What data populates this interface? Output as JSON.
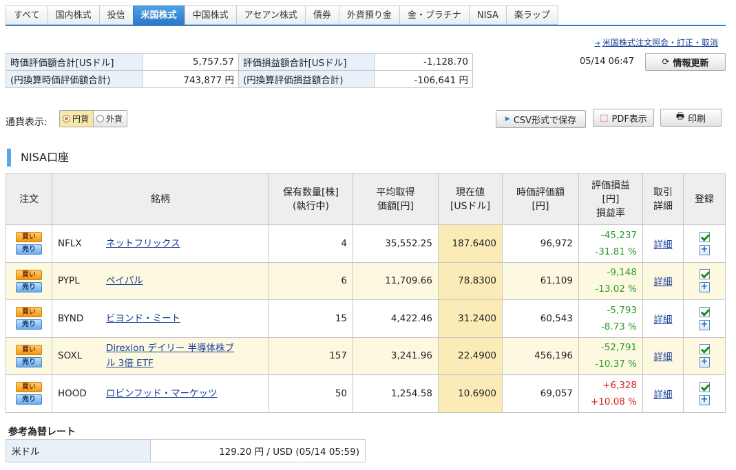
{
  "tabs": [
    {
      "label": "すべて",
      "active": false
    },
    {
      "label": "国内株式",
      "active": false
    },
    {
      "label": "投信",
      "active": false
    },
    {
      "label": "米国株式",
      "active": true
    },
    {
      "label": "中国株式",
      "active": false
    },
    {
      "label": "アセアン株式",
      "active": false
    },
    {
      "label": "債券",
      "active": false
    },
    {
      "label": "外貨預り金",
      "active": false
    },
    {
      "label": "金・プラチナ",
      "active": false
    },
    {
      "label": "NISA",
      "active": false
    },
    {
      "label": "楽ラップ",
      "active": false
    }
  ],
  "header": {
    "order_link": "米国株式注文照会・訂正・取消",
    "update_time": "05/14 06:47",
    "refresh_label": "情報更新"
  },
  "summary": {
    "market_value_usd_label": "時価評価額合計[USドル]",
    "market_value_usd": "5,757.57",
    "pl_usd_label": "評価損益額合計[USドル]",
    "pl_usd": "-1,128.70",
    "market_value_jpy_label": "(円換算時価評価額合計)",
    "market_value_jpy": "743,877 円",
    "pl_jpy_label": "(円換算評価損益額合計)",
    "pl_jpy": "-106,641 円"
  },
  "currency": {
    "label": "通貨表示:",
    "options": [
      "円貨",
      "外貨"
    ],
    "selected": "円貨"
  },
  "actions": {
    "csv_label": "CSV形式で保存",
    "pdf_label": "PDF表示",
    "print_label": "印刷"
  },
  "section": {
    "title": "NISA口座"
  },
  "table": {
    "headers": {
      "order": "注文",
      "name": "銘柄",
      "qty_1": "保有数量[株]",
      "qty_2": "(執行中)",
      "avg_1": "平均取得",
      "avg_2": "価額[円]",
      "cur_1": "現在値",
      "cur_2": "[USドル]",
      "mv_1": "時価評価額",
      "mv_2": "[円]",
      "pl_1": "評価損益",
      "pl_2": "[円]",
      "pl_3": "損益率",
      "detail_1": "取引",
      "detail_2": "詳細",
      "register": "登録"
    },
    "buy_label": "買い",
    "sell_label": "売り",
    "detail_label": "詳細",
    "rows": [
      {
        "ticker": "NFLX",
        "name": "ネットフリックス",
        "qty": "4",
        "avg": "35,552.25",
        "price": "187.6400",
        "mv": "96,972",
        "pl": "-45,237",
        "rate": "-31.81 %",
        "sign": "neg"
      },
      {
        "ticker": "PYPL",
        "name": "ペイパル",
        "qty": "6",
        "avg": "11,709.66",
        "price": "78.8300",
        "mv": "61,109",
        "pl": "-9,148",
        "rate": "-13.02 %",
        "sign": "neg"
      },
      {
        "ticker": "BYND",
        "name": "ビヨンド・ミート",
        "qty": "15",
        "avg": "4,422.46",
        "price": "31.2400",
        "mv": "60,543",
        "pl": "-5,793",
        "rate": "-8.73 %",
        "sign": "neg"
      },
      {
        "ticker": "SOXL",
        "name": "Direxion デイリー 半導体株ブル 3倍 ETF",
        "qty": "157",
        "avg": "3,241.96",
        "price": "22.4900",
        "mv": "456,196",
        "pl": "-52,791",
        "rate": "-10.37 %",
        "sign": "neg"
      },
      {
        "ticker": "HOOD",
        "name": "ロビンフッド・マーケッツ",
        "qty": "50",
        "avg": "1,254.58",
        "price": "10.6900",
        "mv": "69,057",
        "pl": "+6,328",
        "rate": "+10.08 %",
        "sign": "pos"
      }
    ]
  },
  "fx": {
    "title": "参考為替レート",
    "currency": "米ドル",
    "rate": "129.20 円  / USD  (05/14 05:59)"
  },
  "colors": {
    "accent": "#2b7fd0",
    "negative": "#2b9a2b",
    "positive": "#d91f1f",
    "current_price_bg": "#fbecb7"
  }
}
